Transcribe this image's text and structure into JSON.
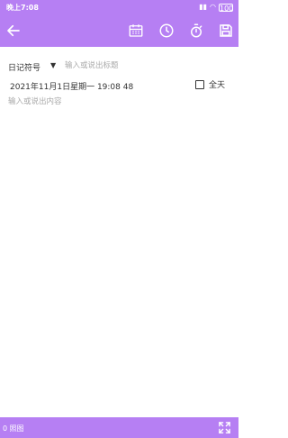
{
  "status_bar": {
    "time": "晚上7:08",
    "battery": "100"
  },
  "toolbar": {
    "icons": [
      "back-arrow-icon",
      "calendar-icon",
      "clock-icon",
      "timer-icon",
      "save-icon"
    ]
  },
  "editor": {
    "diary_symbol": "日记符号",
    "dropdown_caret": "▼",
    "title_placeholder": "输入或说出标题",
    "datetime": "2021年11月1日星期一 19:08 48",
    "all_day_label": "全天",
    "all_day_checked": false,
    "content_placeholder": "输入或说出内容"
  },
  "bottom_bar": {
    "attachments": "0 照图"
  },
  "colors": {
    "accent": "#b67ff3"
  }
}
